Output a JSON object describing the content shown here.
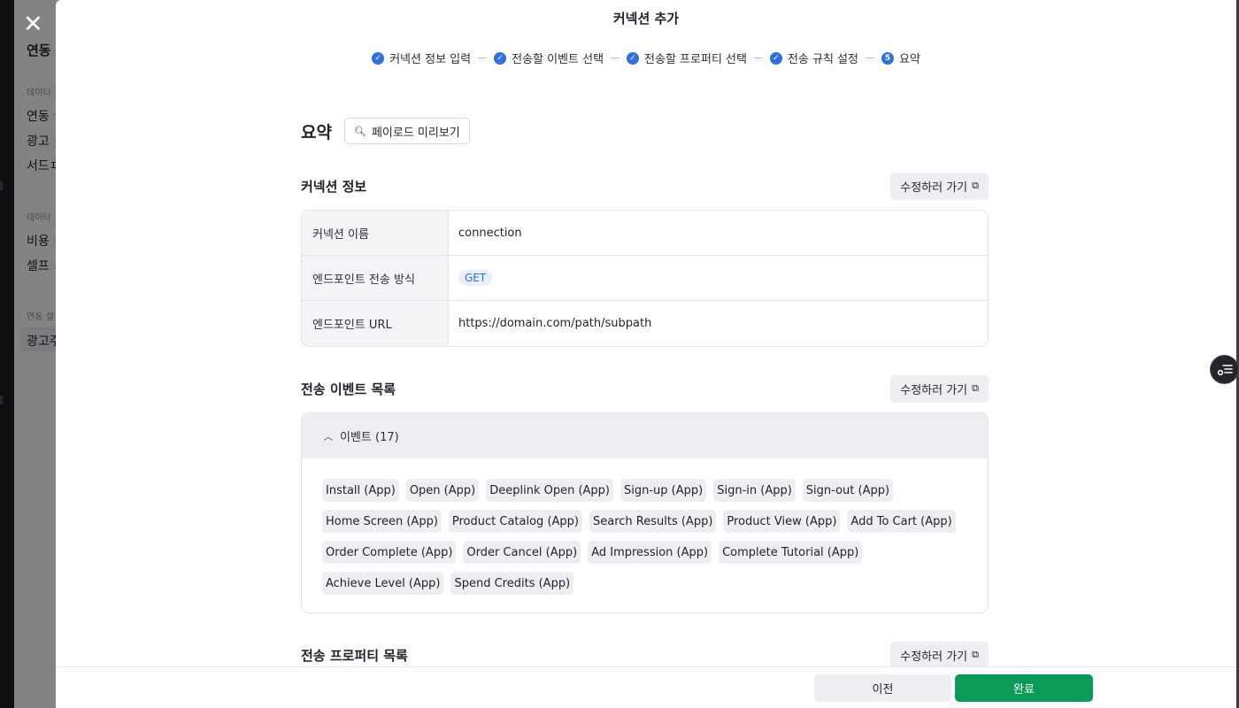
{
  "background": {
    "close_glyph": "✕",
    "sidebar_title": "연동",
    "groups": [
      {
        "heading": "데이터",
        "items": [
          "연동 ㅎ",
          "광고 ㅊ",
          "서드ㅍ"
        ]
      },
      {
        "heading": "데이터",
        "items": [
          "비용 ㄷ",
          "셀프 ㅅ"
        ]
      },
      {
        "heading": "연동 설",
        "items": [
          "광고주"
        ]
      }
    ]
  },
  "modal": {
    "title": "커넥션 추가",
    "steps": [
      {
        "label": "커넥션 정보 입력",
        "state": "done"
      },
      {
        "label": "전송할 이벤트 선택",
        "state": "done"
      },
      {
        "label": "전송할 프로퍼티 선택",
        "state": "done"
      },
      {
        "label": "전송 규칙 설정",
        "state": "done"
      },
      {
        "label": "요약",
        "state": "current",
        "number": "5"
      }
    ]
  },
  "summary": {
    "title": "요약",
    "preview_label": "페이로드 미리보기",
    "preview_icon": "search-icon"
  },
  "connection_info": {
    "title": "커넥션 정보",
    "edit_label": "수정하러 가기",
    "rows": [
      {
        "label": "커넥션 이름",
        "value": "connection"
      },
      {
        "label": "엔드포인트 전송 방식",
        "value": "GET"
      },
      {
        "label": "엔드포인트 URL",
        "value": "https://domain.com/path/subpath"
      }
    ]
  },
  "events": {
    "title": "전송 이벤트 목록",
    "edit_label": "수정하러 가기",
    "group_label": "이벤트 (17)",
    "items": [
      "Install (App)",
      "Open (App)",
      "Deeplink Open (App)",
      "Sign-up (App)",
      "Sign-in (App)",
      "Sign-out (App)",
      "Home Screen (App)",
      "Product Catalog (App)",
      "Search Results (App)",
      "Product View (App)",
      "Add To Cart (App)",
      "Order Complete (App)",
      "Order Cancel (App)",
      "Ad Impression (App)",
      "Complete Tutorial (App)",
      "Achieve Level (App)",
      "Spend Credits (App)"
    ]
  },
  "properties": {
    "title": "전송 프로퍼티 목록",
    "edit_label": "수정하러 가기"
  },
  "footer": {
    "prev_label": "이전",
    "done_label": "완료"
  },
  "colors": {
    "accent": "#2f6fe4",
    "primary_button": "#0a9b58"
  }
}
